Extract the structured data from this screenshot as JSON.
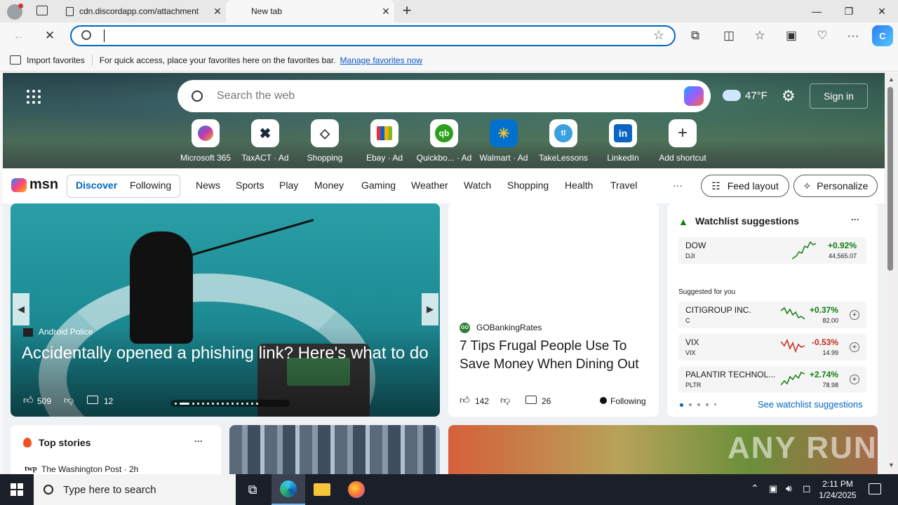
{
  "browser": {
    "tabs": [
      {
        "title": "cdn.discordapp.com/attachment"
      },
      {
        "title": "New tab"
      }
    ],
    "new_tab_symbol": "+",
    "address_value": "",
    "favorites_bar": {
      "import_label": "Import favorites",
      "message": "For quick access, place your favorites here on the favorites bar.",
      "manage_link": "Manage favorites now"
    }
  },
  "hero": {
    "search_placeholder": "Search the web",
    "weather": "47°F",
    "sign_in": "Sign in",
    "shortcuts": [
      {
        "label": "Microsoft 365",
        "icon": "microsoft-365-icon"
      },
      {
        "label": "TaxACT · Ad",
        "icon": "taxact-icon"
      },
      {
        "label": "Shopping",
        "icon": "tag-icon"
      },
      {
        "label": "Ebay · Ad",
        "icon": "ebay-bag-icon"
      },
      {
        "label": "Quickbo... · Ad",
        "icon": "quickbooks-icon",
        "glyph": "qb"
      },
      {
        "label": "Walmart · Ad",
        "icon": "walmart-icon",
        "glyph": "✳"
      },
      {
        "label": "TakeLessons",
        "icon": "takelessons-icon",
        "glyph": "tl"
      },
      {
        "label": "LinkedIn",
        "icon": "linkedin-icon",
        "glyph": "in"
      },
      {
        "label": "Add shortcut",
        "icon": "plus-icon",
        "glyph": "+"
      }
    ]
  },
  "msn": {
    "logo": "msn",
    "tabs": [
      "Discover",
      "Following"
    ],
    "nav": [
      "News",
      "Sports",
      "Play",
      "Money",
      "Gaming",
      "Weather",
      "Watch",
      "Shopping",
      "Health",
      "Travel"
    ],
    "more": "···",
    "feed_layout": "Feed layout",
    "personalize": "Personalize"
  },
  "main_story": {
    "source": "Android Police",
    "headline": "Accidentally opened a phishing link? Here's what to do",
    "likes": "509",
    "comments": "12"
  },
  "second_story": {
    "source": "GOBankingRates",
    "source_icon_text": "GO",
    "headline": "7 Tips Frugal People Use To Save Money When Dining Out",
    "likes": "142",
    "comments": "26",
    "following": "Following"
  },
  "watchlist": {
    "title": "Watchlist suggestions",
    "more": "···",
    "main": {
      "name": "DOW",
      "symbol": "DJI",
      "change": "+0.92%",
      "price": "44,565.07"
    },
    "suggested_label": "Suggested for you",
    "suggestions": [
      {
        "name": "CITIGROUP INC.",
        "symbol": "C",
        "change": "+0.37%",
        "price": "82.00",
        "dir": "up"
      },
      {
        "name": "VIX",
        "symbol": "VIX",
        "change": "-0.53%",
        "price": "14.99",
        "dir": "dn"
      },
      {
        "name": "PALANTIR TECHNOL...",
        "symbol": "PLTR",
        "change": "+2.74%",
        "price": "78.98",
        "dir": "up"
      }
    ],
    "see_more": "See watchlist suggestions"
  },
  "top_stories": {
    "title": "Top stories",
    "more": "···",
    "first_source_logo": "twp",
    "first_source": "The Washington Post · 2h"
  },
  "watermark": "ANY RUN",
  "taskbar": {
    "search_placeholder": "Type here to search",
    "time": "2:11 PM",
    "date": "1/24/2025"
  }
}
